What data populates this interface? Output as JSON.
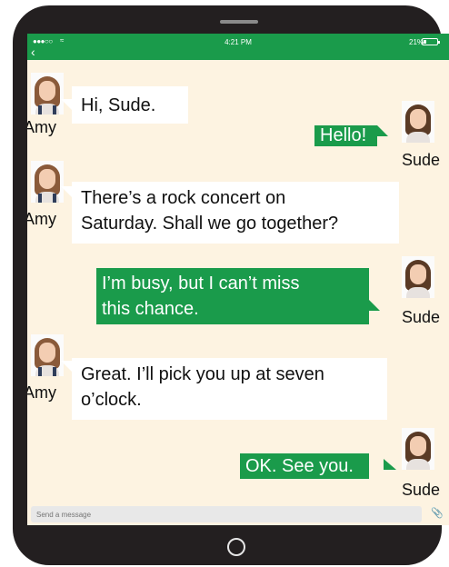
{
  "status": {
    "signal": "●●●○○",
    "time": "4:21 PM",
    "battery": "21%",
    "battery_level": 0.21
  },
  "nav": {
    "back_icon": "chevron-left-icon"
  },
  "messages": [
    {
      "sender": "Amy",
      "text": "Hi, Sude."
    },
    {
      "sender": "Sude",
      "text": "Hello!"
    },
    {
      "sender": "Amy",
      "text_line1": "There’s a rock concert on",
      "text_line2": "Saturday. Shall we go together?"
    },
    {
      "sender": "Sude",
      "text_line1": "I’m busy, but I can’t miss",
      "text_line2": "this chance."
    },
    {
      "sender": "Amy",
      "text_line1": "Great. I’ll pick you up at seven",
      "text_line2": "o’clock."
    },
    {
      "sender": "Sude",
      "text": "OK. See you."
    }
  ],
  "composer": {
    "placeholder": "Send a message",
    "attach_icon": "paperclip-icon"
  },
  "colors": {
    "accent": "#1a9b4b",
    "chat_background": "#fdf3e1",
    "device": "#231f20"
  }
}
